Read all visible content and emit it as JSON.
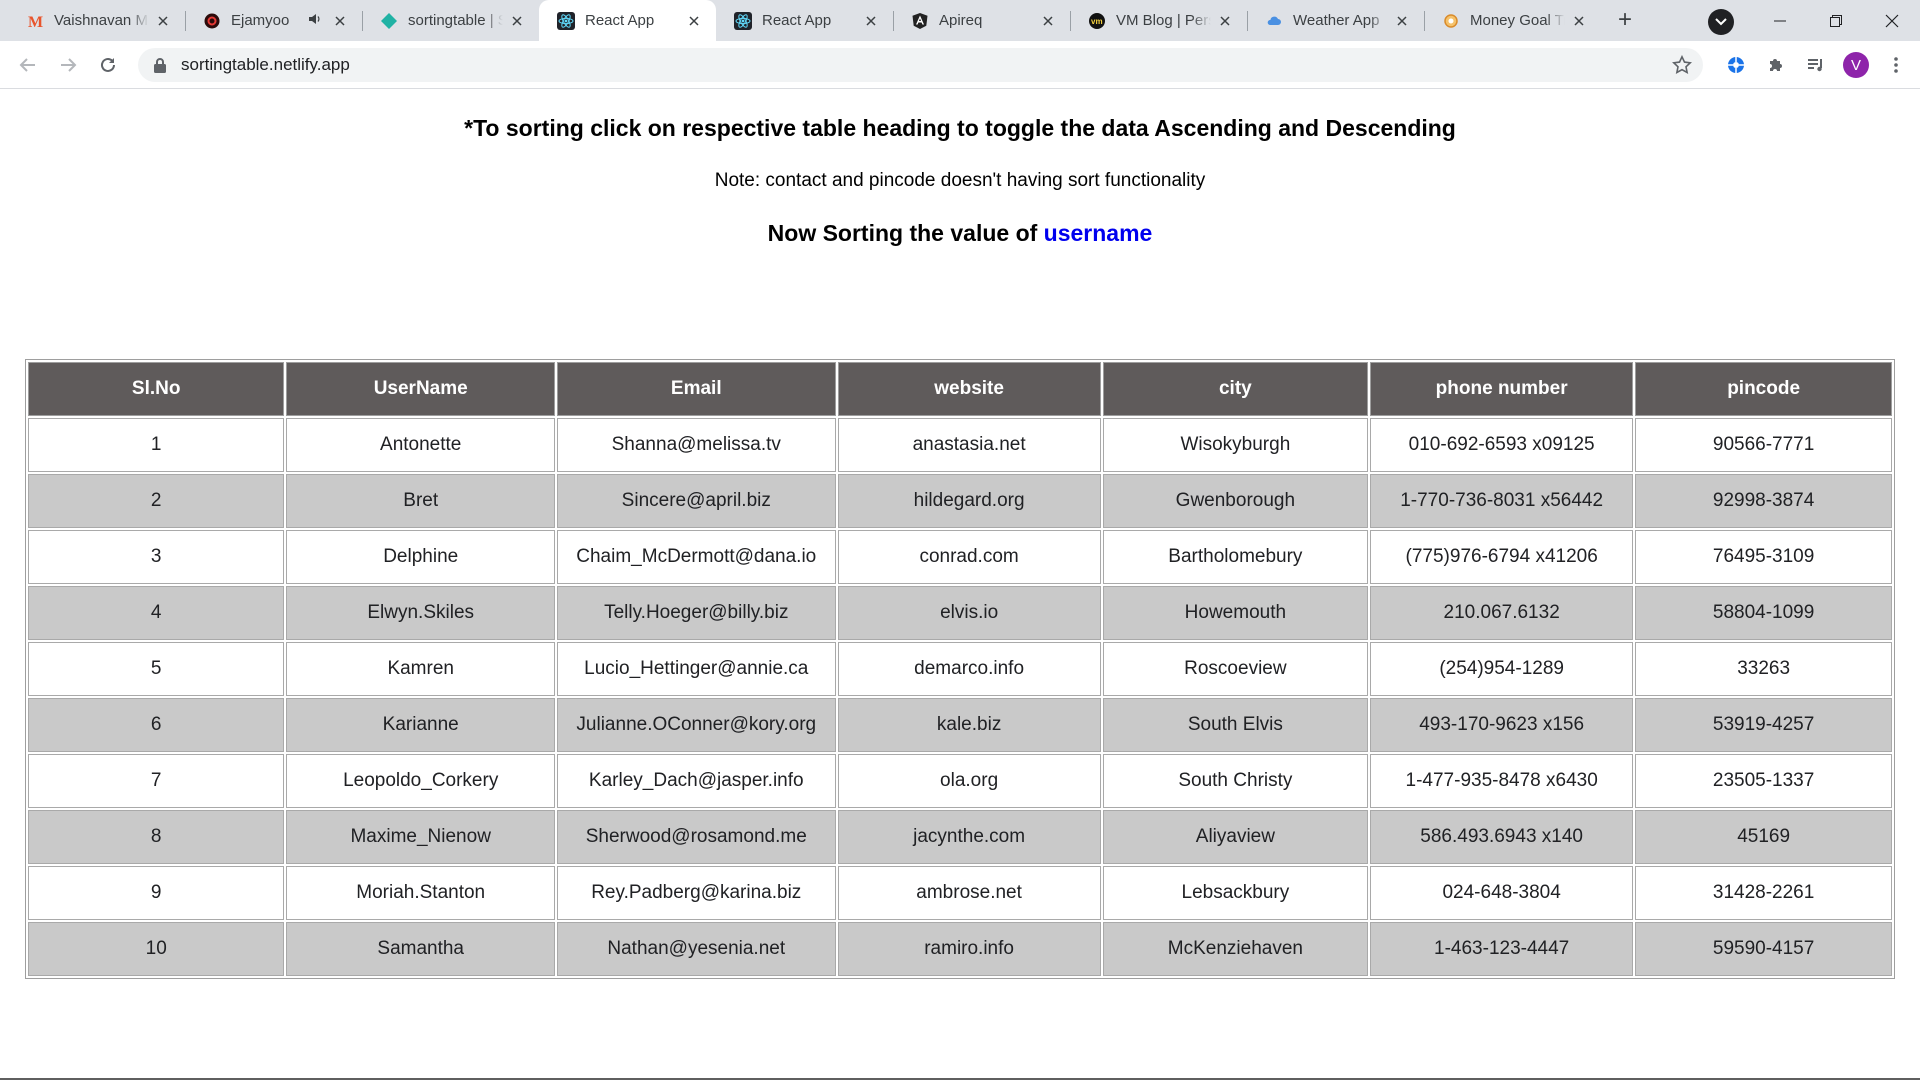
{
  "browser": {
    "tabs": [
      {
        "title": "Vaishnavan M",
        "favicon": "m-letter-icon",
        "active": false
      },
      {
        "title": "Ejamyoo",
        "favicon": "ejamyoo-logo-icon",
        "active": false,
        "audio": true
      },
      {
        "title": "sortingtable | S",
        "favicon": "netlify-diamond-icon",
        "active": false
      },
      {
        "title": "React App",
        "favicon": "react-atom-icon",
        "active": true
      },
      {
        "title": "React App",
        "favicon": "react-atom-icon",
        "active": false
      },
      {
        "title": "Apireq",
        "favicon": "angular-a-icon",
        "active": false
      },
      {
        "title": "VM Blog | Pers",
        "favicon": "vm-logo-icon",
        "active": false
      },
      {
        "title": "Weather App",
        "favicon": "cloud-icon",
        "active": false
      },
      {
        "title": "Money Goal Tr",
        "favicon": "coin-icon",
        "active": false
      }
    ],
    "url": "sortingtable.netlify.app",
    "profile_initial": "V"
  },
  "page": {
    "heading": "*To sorting click on respective table heading to toggle the data Ascending and Descending",
    "note": "Note: contact and pincode doesn't having sort functionality",
    "sorting_prefix": "Now Sorting the value of",
    "sorting_key": "username"
  },
  "table": {
    "headers": [
      "Sl.No",
      "UserName",
      "Email",
      "website",
      "city",
      "phone number",
      "pincode"
    ],
    "rows": [
      [
        "1",
        "Antonette",
        "Shanna@melissa.tv",
        "anastasia.net",
        "Wisokyburgh",
        "010-692-6593 x09125",
        "90566-7771"
      ],
      [
        "2",
        "Bret",
        "Sincere@april.biz",
        "hildegard.org",
        "Gwenborough",
        "1-770-736-8031 x56442",
        "92998-3874"
      ],
      [
        "3",
        "Delphine",
        "Chaim_McDermott@dana.io",
        "conrad.com",
        "Bartholomebury",
        "(775)976-6794 x41206",
        "76495-3109"
      ],
      [
        "4",
        "Elwyn.Skiles",
        "Telly.Hoeger@billy.biz",
        "elvis.io",
        "Howemouth",
        "210.067.6132",
        "58804-1099"
      ],
      [
        "5",
        "Kamren",
        "Lucio_Hettinger@annie.ca",
        "demarco.info",
        "Roscoeview",
        "(254)954-1289",
        "33263"
      ],
      [
        "6",
        "Karianne",
        "Julianne.OConner@kory.org",
        "kale.biz",
        "South Elvis",
        "493-170-9623 x156",
        "53919-4257"
      ],
      [
        "7",
        "Leopoldo_Corkery",
        "Karley_Dach@jasper.info",
        "ola.org",
        "South Christy",
        "1-477-935-8478 x6430",
        "23505-1337"
      ],
      [
        "8",
        "Maxime_Nienow",
        "Sherwood@rosamond.me",
        "jacynthe.com",
        "Aliyaview",
        "586.493.6943 x140",
        "45169"
      ],
      [
        "9",
        "Moriah.Stanton",
        "Rey.Padberg@karina.biz",
        "ambrose.net",
        "Lebsackbury",
        "024-648-3804",
        "31428-2261"
      ],
      [
        "10",
        "Samantha",
        "Nathan@yesenia.net",
        "ramiro.info",
        "McKenziehaven",
        "1-463-123-4447",
        "59590-4157"
      ]
    ]
  }
}
